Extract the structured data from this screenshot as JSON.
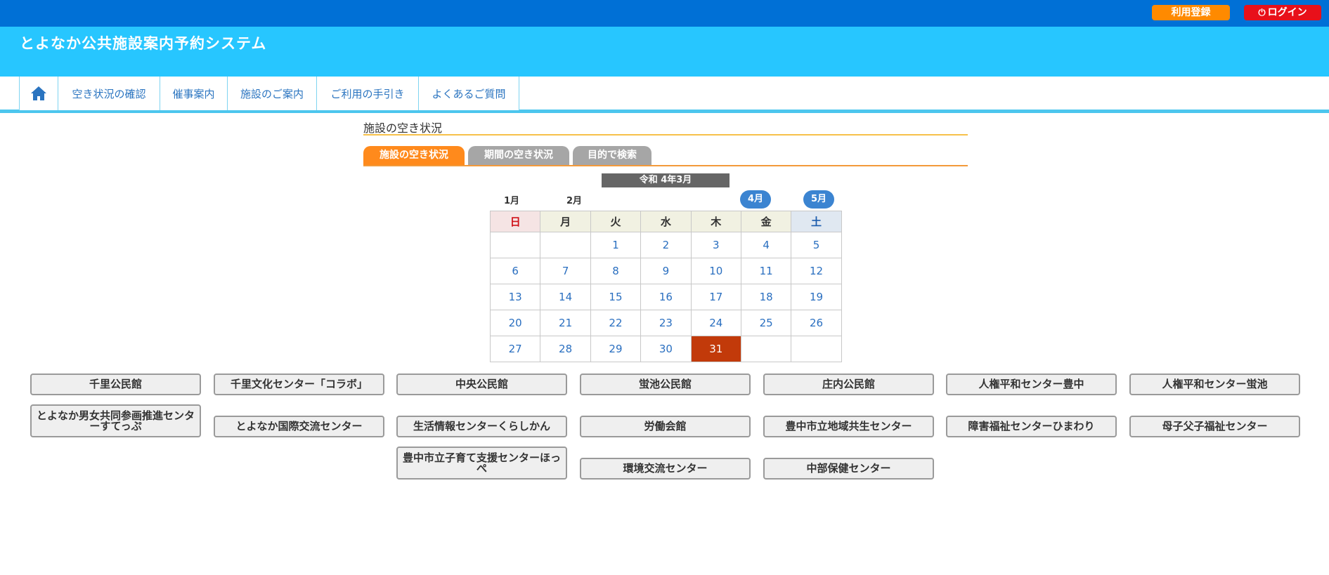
{
  "topbar": {
    "register_label": "利用登録",
    "login_label": "ログイン",
    "login_icon": "power-icon"
  },
  "header": {
    "title": "とよなか公共施設案内予約システム"
  },
  "nav": {
    "home_icon": "home-icon",
    "items": [
      {
        "label": "空き状況の確認"
      },
      {
        "label": "催事案内"
      },
      {
        "label": "施設のご案内"
      },
      {
        "label": "ご利用の手引き"
      },
      {
        "label": "よくあるご質問"
      }
    ]
  },
  "section": {
    "title": "施設の空き状況"
  },
  "tabs": [
    {
      "label": "施設の空き状況",
      "active": true
    },
    {
      "label": "期間の空き状況",
      "active": false
    },
    {
      "label": "目的で検索",
      "active": false
    }
  ],
  "calendar": {
    "title": "令和 4年3月",
    "months": {
      "jan": "1月",
      "feb": "2月",
      "apr": "4月",
      "may": "5月"
    },
    "weekdays": [
      "日",
      "月",
      "火",
      "水",
      "木",
      "金",
      "土"
    ],
    "weeks": [
      [
        "",
        "",
        "1",
        "2",
        "3",
        "4",
        "5"
      ],
      [
        "6",
        "7",
        "8",
        "9",
        "10",
        "11",
        "12"
      ],
      [
        "13",
        "14",
        "15",
        "16",
        "17",
        "18",
        "19"
      ],
      [
        "20",
        "21",
        "22",
        "23",
        "24",
        "25",
        "26"
      ],
      [
        "27",
        "28",
        "29",
        "30",
        "31",
        "",
        ""
      ]
    ],
    "today": "31"
  },
  "facilities": [
    {
      "label": "千里公民館"
    },
    {
      "label": "千里文化センター「コラボ」"
    },
    {
      "label": "中央公民館"
    },
    {
      "label": "蛍池公民館"
    },
    {
      "label": "庄内公民館"
    },
    {
      "label": "人権平和センター豊中"
    },
    {
      "label": "人権平和センター蛍池"
    },
    {
      "label": "とよなか男女共同参画推進センターすてっぷ"
    },
    {
      "label": "とよなか国際交流センター"
    },
    {
      "label": "生活情報センターくらしかん"
    },
    {
      "label": "労働会館"
    },
    {
      "label": "豊中市立地域共生センター"
    },
    {
      "label": "障害福祉センターひまわり"
    },
    {
      "label": "母子父子福祉センター"
    },
    {
      "label": "豊中市立子育て支援センターほっぺ"
    },
    {
      "label": "環境交流センター"
    },
    {
      "label": "中部保健センター"
    }
  ],
  "colors": {
    "topbar": "#0070d6",
    "header": "#27c6ff",
    "register": "#ff8a00",
    "login": "#e8101a",
    "active_tab": "#ff8a1c",
    "inactive_tab": "#a6a6a6",
    "today": "#c23a0a"
  }
}
